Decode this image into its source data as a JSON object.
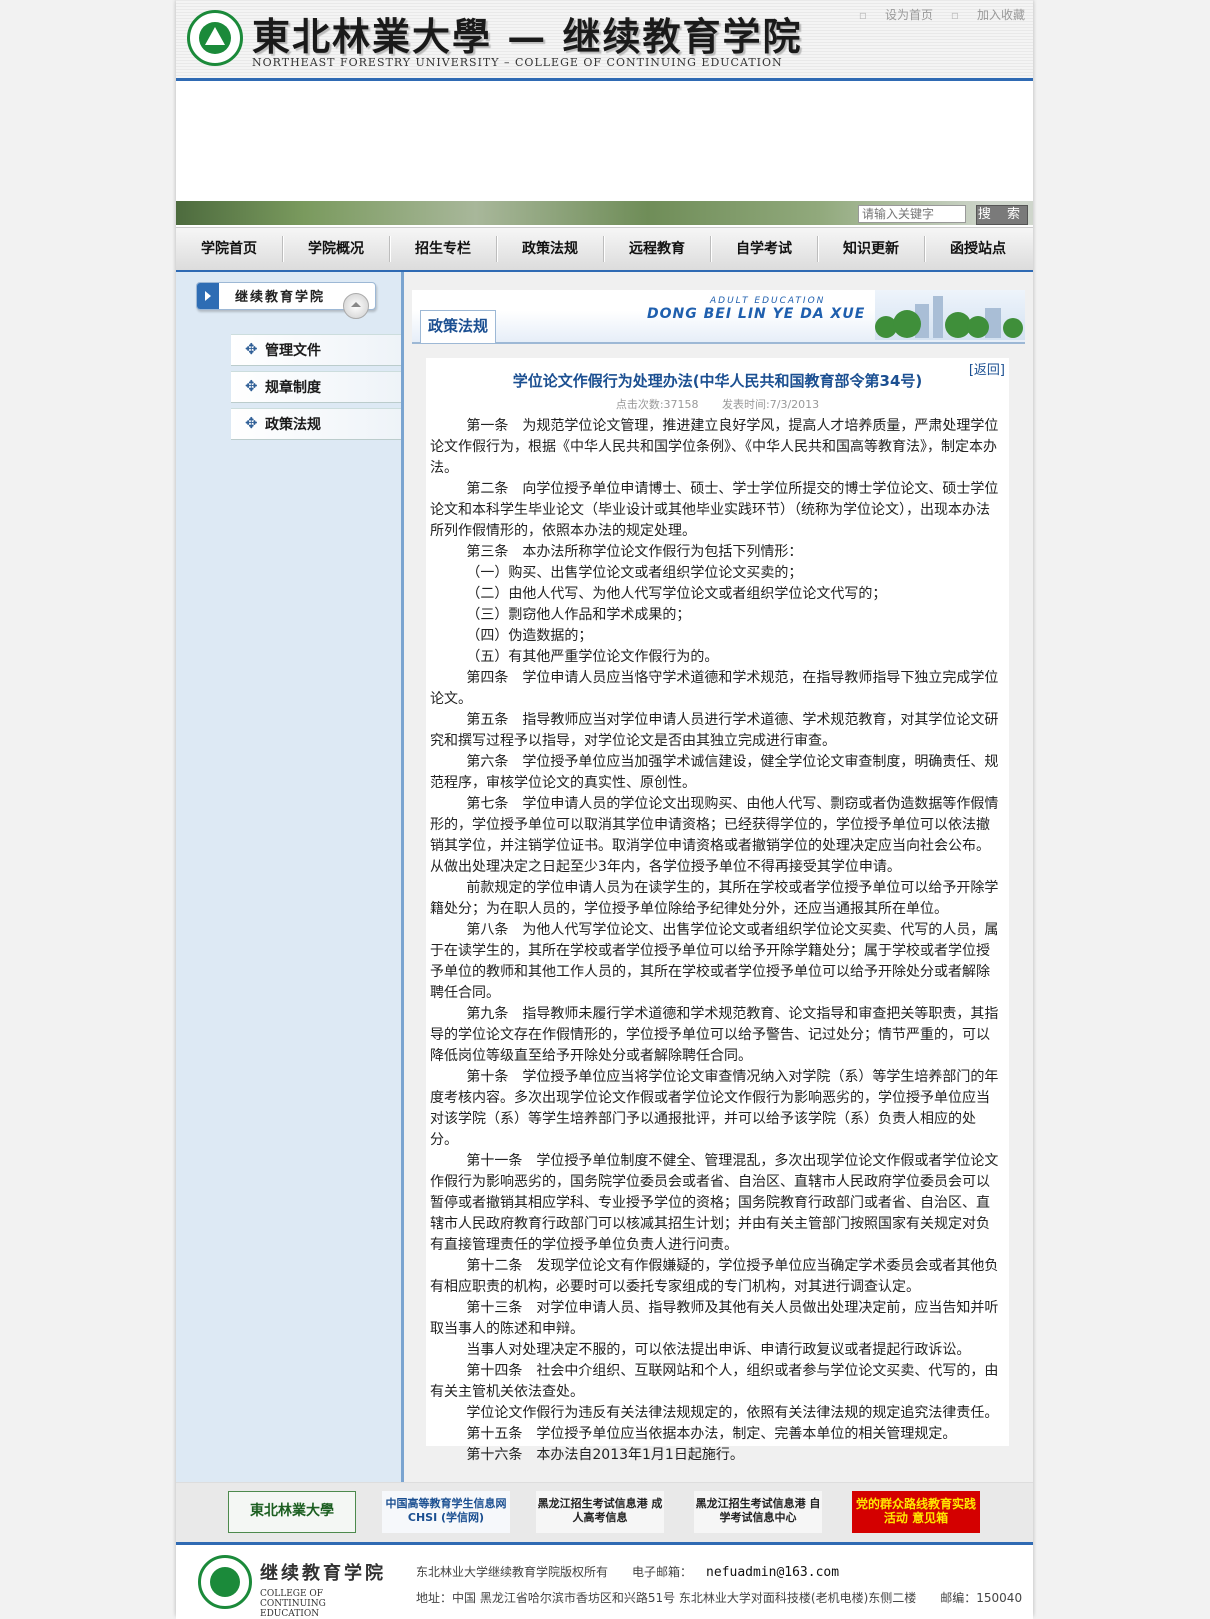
{
  "header": {
    "brand_cn": "東北林業大學 — 继续教育学院",
    "brand_en": "NORTHEAST FORESTRY UNIVERSITY – COLLEGE OF CONTINUING EDUCATION",
    "toplinks": [
      "设为首页",
      "加入收藏"
    ]
  },
  "search": {
    "placeholder": "请输入关键字",
    "button_label": "搜 索"
  },
  "nav": [
    "学院首页",
    "学院概况",
    "招生专栏",
    "政策法规",
    "远程教育",
    "自学考试",
    "知识更新",
    "函授站点"
  ],
  "sidebar": {
    "title": "继续教育学院",
    "items": [
      "管理文件",
      "规章制度",
      "政策法规"
    ]
  },
  "category": {
    "label": "政策法规",
    "banner_text": "DONG BEI LIN YE DA XUE",
    "banner_small": "ADULT EDUCATION"
  },
  "article": {
    "back": "[返回]",
    "title": "学位论文作假行为处理办法(中华人民共和国教育部令第34号)",
    "hits": "点击次数:37158",
    "date": "发表时间:7/3/2013",
    "paragraphs": [
      "第一条　为规范学位论文管理，推进建立良好学风，提高人才培养质量，严肃处理学位论文作假行为，根据《中华人民共和国学位条例》、《中华人民共和国高等教育法》，制定本办法。",
      "第二条　向学位授予单位申请博士、硕士、学士学位所提交的博士学位论文、硕士学位论文和本科学生毕业论文（毕业设计或其他毕业实践环节）（统称为学位论文），出现本办法所列作假情形的，依照本办法的规定处理。",
      "第三条　本办法所称学位论文作假行为包括下列情形：",
      "（一）购买、出售学位论文或者组织学位论文买卖的；",
      "（二）由他人代写、为他人代写学位论文或者组织学位论文代写的；",
      "（三）剽窃他人作品和学术成果的；",
      "（四）伪造数据的；",
      "（五）有其他严重学位论文作假行为的。",
      "第四条　学位申请人员应当恪守学术道德和学术规范，在指导教师指导下独立完成学位论文。",
      "第五条　指导教师应当对学位申请人员进行学术道德、学术规范教育，对其学位论文研究和撰写过程予以指导，对学位论文是否由其独立完成进行审查。",
      "第六条　学位授予单位应当加强学术诚信建设，健全学位论文审查制度，明确责任、规范程序，审核学位论文的真实性、原创性。",
      "第七条　学位申请人员的学位论文出现购买、由他人代写、剽窃或者伪造数据等作假情形的，学位授予单位可以取消其学位申请资格；已经获得学位的，学位授予单位可以依法撤销其学位，并注销学位证书。取消学位申请资格或者撤销学位的处理决定应当向社会公布。从做出处理决定之日起至少3年内，各学位授予单位不得再接受其学位申请。",
      "前款规定的学位申请人员为在读学生的，其所在学校或者学位授予单位可以给予开除学籍处分；为在职人员的，学位授予单位除给予纪律处分外，还应当通报其所在单位。",
      "第八条　为他人代写学位论文、出售学位论文或者组织学位论文买卖、代写的人员，属于在读学生的，其所在学校或者学位授予单位可以给予开除学籍处分；属于学校或者学位授予单位的教师和其他工作人员的，其所在学校或者学位授予单位可以给予开除处分或者解除聘任合同。",
      "第九条　指导教师未履行学术道德和学术规范教育、论文指导和审查把关等职责，其指导的学位论文存在作假情形的，学位授予单位可以给予警告、记过处分；情节严重的，可以降低岗位等级直至给予开除处分或者解除聘任合同。",
      "第十条　学位授予单位应当将学位论文审查情况纳入对学院（系）等学生培养部门的年度考核内容。多次出现学位论文作假或者学位论文作假行为影响恶劣的，学位授予单位应当对该学院（系）等学生培养部门予以通报批评，并可以给予该学院（系）负责人相应的处分。",
      "第十一条　学位授予单位制度不健全、管理混乱，多次出现学位论文作假或者学位论文作假行为影响恶劣的，国务院学位委员会或者省、自治区、直辖市人民政府学位委员会可以暂停或者撤销其相应学科、专业授予学位的资格；国务院教育行政部门或者省、自治区、直辖市人民政府教育行政部门可以核减其招生计划；并由有关主管部门按照国家有关规定对负有直接管理责任的学位授予单位负责人进行问责。",
      "第十二条　发现学位论文有作假嫌疑的，学位授予单位应当确定学术委员会或者其他负有相应职责的机构，必要时可以委托专家组成的专门机构，对其进行调查认定。",
      "第十三条　对学位申请人员、指导教师及其他有关人员做出处理决定前，应当告知并听取当事人的陈述和申辩。",
      "当事人对处理决定不服的，可以依法提出申诉、申请行政复议或者提起行政诉讼。",
      "第十四条　社会中介组织、互联网站和个人，组织或者参与学位论文买卖、代写的，由有关主管机关依法查处。",
      "学位论文作假行为违反有关法律法规规定的，依照有关法律法规的规定追究法律责任。",
      "第十五条　学位授予单位应当依据本办法，制定、完善本单位的相关管理规定。",
      "第十六条　本办法自2013年1月1日起施行。"
    ]
  },
  "footer_links": [
    "東北林業大學",
    "中国高等教育学生信息网 CHSI (学信网)",
    "黑龙江招生考试信息港 成人高考信息",
    "黑龙江招生考试信息港 自学考试信息中心",
    "党的群众路线教育实践活动 意见箱"
  ],
  "copyright": {
    "name": "继续教育学院",
    "name_en": "COLLEGE OF CONTINUING EDUCATION",
    "line1": "东北林业大学继续教育学院版权所有　　电子邮箱：",
    "email": "nefuadmin@163.com",
    "line2": "地址：中国 黑龙江省哈尔滨市香坊区和兴路51号 东北林业大学对面科技楼(老机电楼)东侧二楼　　邮编：150040"
  },
  "colors": {
    "accent": "#2f6ab3",
    "title": "#1b4f91",
    "sidebar_bg": "#dde9f4"
  }
}
